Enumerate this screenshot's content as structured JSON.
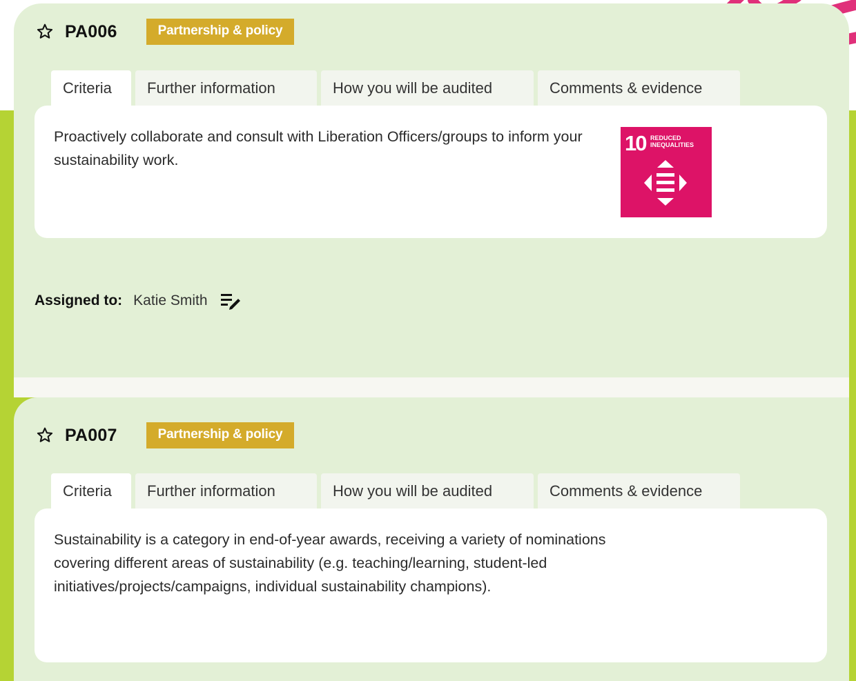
{
  "criteria": [
    {
      "id": "PA006",
      "tag": "Partnership & policy",
      "tabs": [
        "Criteria",
        "Further information",
        "How you will be audited",
        "Comments & evidence"
      ],
      "active_tab": "Criteria",
      "text": "Proactively collaborate and consult with Liberation Officers/groups to inform your sustainability work.",
      "sdg": {
        "number": "10",
        "title": "Reduced inequalities",
        "color": "#dd1367",
        "icon": "reduced-inequalities-icon"
      },
      "assigned_label": "Assigned to:",
      "assigned_name": "Katie Smith"
    },
    {
      "id": "PA007",
      "tag": "Partnership & policy",
      "tabs": [
        "Criteria",
        "Further information",
        "How you will be audited",
        "Comments & evidence"
      ],
      "active_tab": "Criteria",
      "text": "Sustainability is a category in end-of-year awards, receiving a variety of nominations covering different areas of sustainability (e.g. teaching/learning, student-led initiatives/projects/campaigns, individual sustainability champions)."
    }
  ],
  "colors": {
    "lime_background": "#b5d334",
    "card_background": "#e3f0d6",
    "tag_background": "#d4ab2b",
    "brush_accent": "#e0307a"
  }
}
